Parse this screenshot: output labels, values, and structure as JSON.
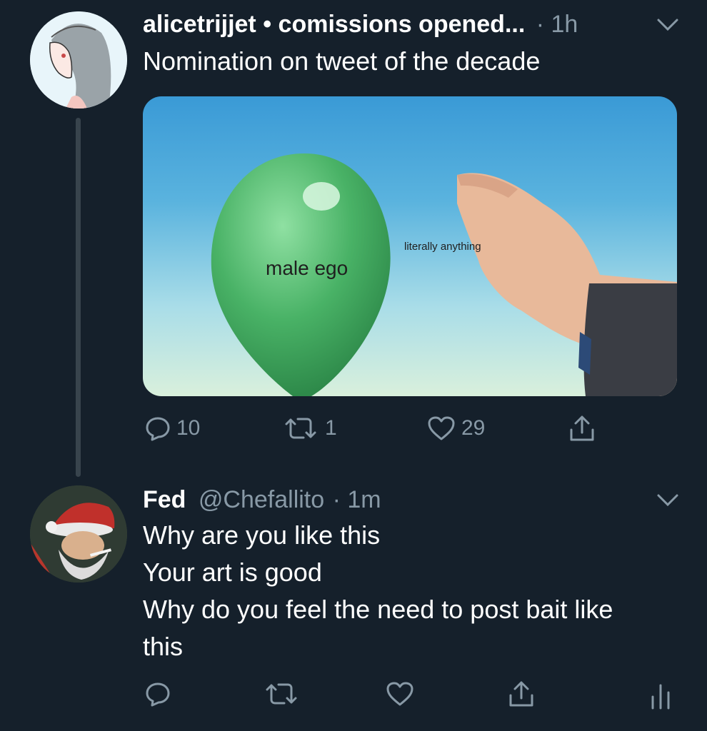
{
  "tweet1": {
    "display_name": "alicetrijjet • comissions opened...",
    "time": "· 1h",
    "text": "Nomination on tweet of the decade",
    "media": {
      "balloon_label": "male ego",
      "finger_label": "literally anything"
    },
    "actions": {
      "replies": "10",
      "retweets": "1",
      "likes": "29"
    }
  },
  "tweet2": {
    "display_name": "Fed",
    "handle": "@Chefallito",
    "time": "· 1m",
    "lines": [
      "Why are you like this",
      "Your art is good",
      "Why do you feel the need to post bait like",
      "this"
    ]
  },
  "colors": {
    "background": "#15202b",
    "muted": "#8899a6",
    "thread_line": "#38444d"
  }
}
